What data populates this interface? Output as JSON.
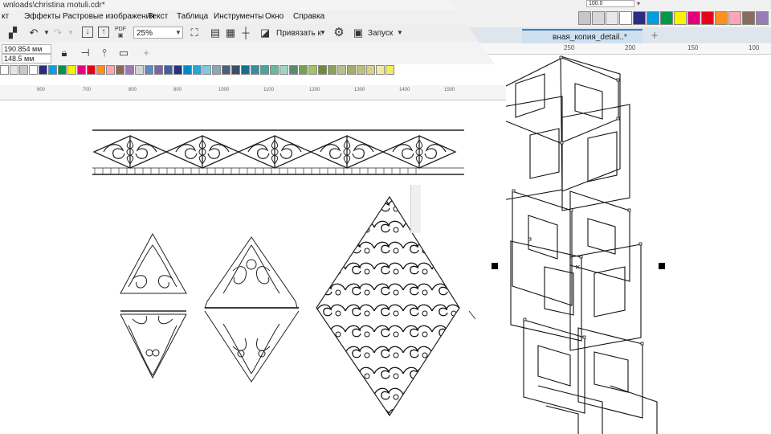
{
  "window": {
    "title": "wnloads\\christina motuli.cdr*"
  },
  "menu": [
    "кт",
    "Эффекты",
    "Растровые изображения",
    "Текст",
    "Таблица",
    "Инструменты",
    "Окно",
    "Справка"
  ],
  "toolbar": {
    "zoom_value": "25%",
    "snap_label": "Привязать к",
    "launch_label": "Запуск",
    "icons": [
      "paste-icon",
      "undo-icon",
      "redo-icon",
      "import-icon",
      "export-icon",
      "pdf-icon",
      "fullscreen-icon",
      "welcome-icon",
      "grid-icon",
      "guides-icon",
      "snap-off-icon",
      "options-gear-icon",
      "launch-icon"
    ]
  },
  "property_bar": {
    "x_value": "190.854 мм",
    "y_value": "148.5 мм",
    "icons": [
      "lock-ratio-icon",
      "node-align-icon",
      "transform-icon",
      "frame-icon",
      "add-icon"
    ]
  },
  "palette_left": [
    "#ffffff",
    "#e6e6e6",
    "#c8c8c8",
    "#ffffff",
    "#2b2d84",
    "#00a0e3",
    "#00934b",
    "#fff200",
    "#e3007d",
    "#e4001b",
    "#ff8e1f",
    "#ffa6b1",
    "#8b6a5a",
    "#9c79b6",
    "#d1d3d4",
    "#5d8ac4",
    "#7b63a8",
    "#3f5fa7",
    "#28337f",
    "#0088c9",
    "#2aa4d8",
    "#7ec8e6",
    "#8ea5b6",
    "#4a6377",
    "#3b4e63",
    "#1b6e8e",
    "#3a8d9a",
    "#46a79f",
    "#6bb7a5",
    "#a1d3c2",
    "#5c8a73",
    "#79a14d",
    "#a7c261",
    "#6d8a3b",
    "#8da05c",
    "#b6c189",
    "#a4ad6c",
    "#c1c079",
    "#d9d08e",
    "#f2e9a0",
    "#f4ea5f"
  ],
  "ruler_left": [
    "800",
    "700",
    "800",
    "800",
    "1000",
    "1100",
    "1200",
    "1300",
    "1400",
    "1500"
  ],
  "overlay": {
    "tab_title": "вная_копия_detail..*",
    "field_value": "100.0",
    "palette": [
      "#c6c6c6",
      "#d7d7d7",
      "#e8e8e8",
      "#ffffff",
      "#2b2d84",
      "#009ee0",
      "#00984a",
      "#fff200",
      "#e4007c",
      "#e5001c",
      "#ff8f1e",
      "#ffa6b2",
      "#8a6c5c",
      "#9b7ab8"
    ],
    "ruler": [
      "250",
      "200",
      "150",
      "100"
    ]
  },
  "colors": {
    "menu_bg": "#f0f0f0",
    "tab_accent": "#3c7dc6",
    "selection_handle": "#000000"
  }
}
